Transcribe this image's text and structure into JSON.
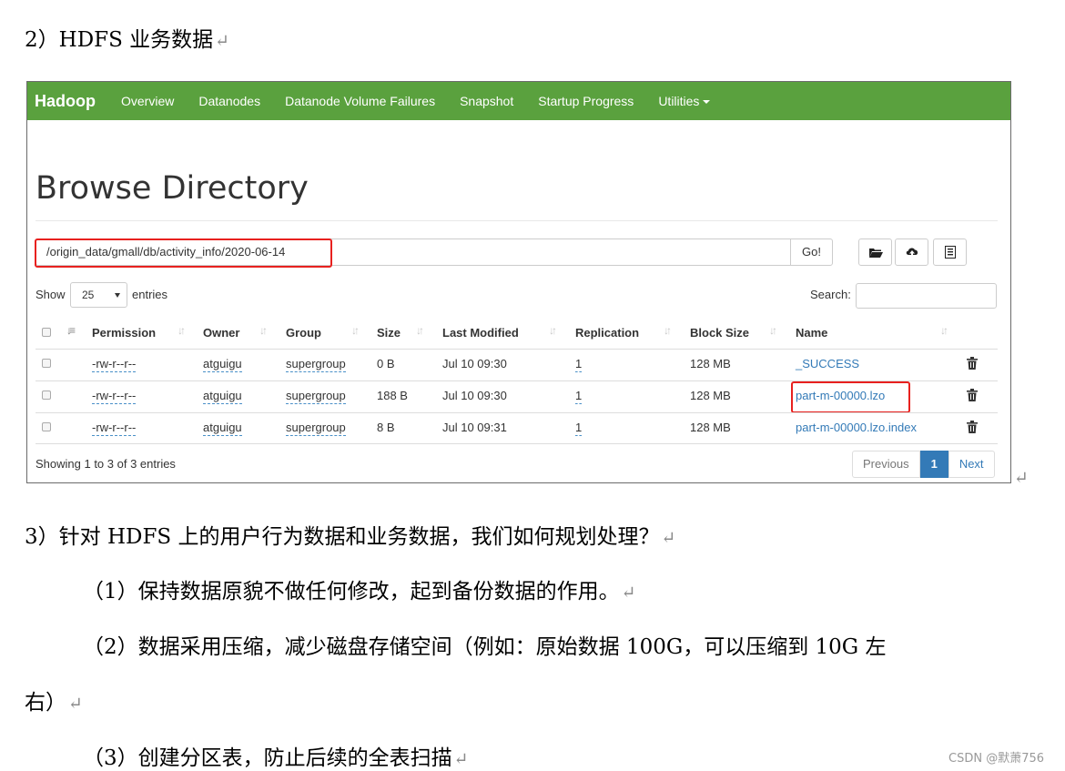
{
  "doc": {
    "heading": "2）HDFS 业务数据",
    "q3": "3）针对 HDFS 上的用户行为数据和业务数据，我们如何规划处理？",
    "p1": "（1）保持数据原貌不做任何修改，起到备份数据的作用。",
    "p2a": "（2）数据采用压缩，减少磁盘存储空间（例如：原始数据 100G，可以压缩到 10G 左",
    "p2b": "右）",
    "p3": "（3）创建分区表，防止后续的全表扫描",
    "return_mark": "↵"
  },
  "navbar": {
    "brand": "Hadoop",
    "items": [
      "Overview",
      "Datanodes",
      "Datanode Volume Failures",
      "Snapshot",
      "Startup Progress",
      "Utilities"
    ],
    "color": "#5aa13e"
  },
  "browser": {
    "title": "Browse Directory",
    "path": "/origin_data/gmall/db/activity_info/2020-06-14",
    "go_label": "Go!",
    "show_label": "Show",
    "page_size": "25",
    "entries_label": "entries",
    "search_label": "Search:",
    "search_value": ""
  },
  "table": {
    "headers": [
      "Permission",
      "Owner",
      "Group",
      "Size",
      "Last Modified",
      "Replication",
      "Block Size",
      "Name"
    ],
    "rows": [
      {
        "permission": "-rw-r--r--",
        "owner": "atguigu",
        "group": "supergroup",
        "size": "0 B",
        "modified": "Jul 10 09:30",
        "replication": "1",
        "block_size": "128 MB",
        "name": "_SUCCESS"
      },
      {
        "permission": "-rw-r--r--",
        "owner": "atguigu",
        "group": "supergroup",
        "size": "188 B",
        "modified": "Jul 10 09:30",
        "replication": "1",
        "block_size": "128 MB",
        "name": "part-m-00000.lzo"
      },
      {
        "permission": "-rw-r--r--",
        "owner": "atguigu",
        "group": "supergroup",
        "size": "8 B",
        "modified": "Jul 10 09:31",
        "replication": "1",
        "block_size": "128 MB",
        "name": "part-m-00000.lzo.index"
      }
    ]
  },
  "footer": {
    "showing": "Showing 1 to 3 of 3 entries",
    "prev": "Previous",
    "page": "1",
    "next": "Next"
  },
  "highlight_color": "#e8211f",
  "link_color": "#337ab7",
  "watermark": "CSDN @默萧756"
}
